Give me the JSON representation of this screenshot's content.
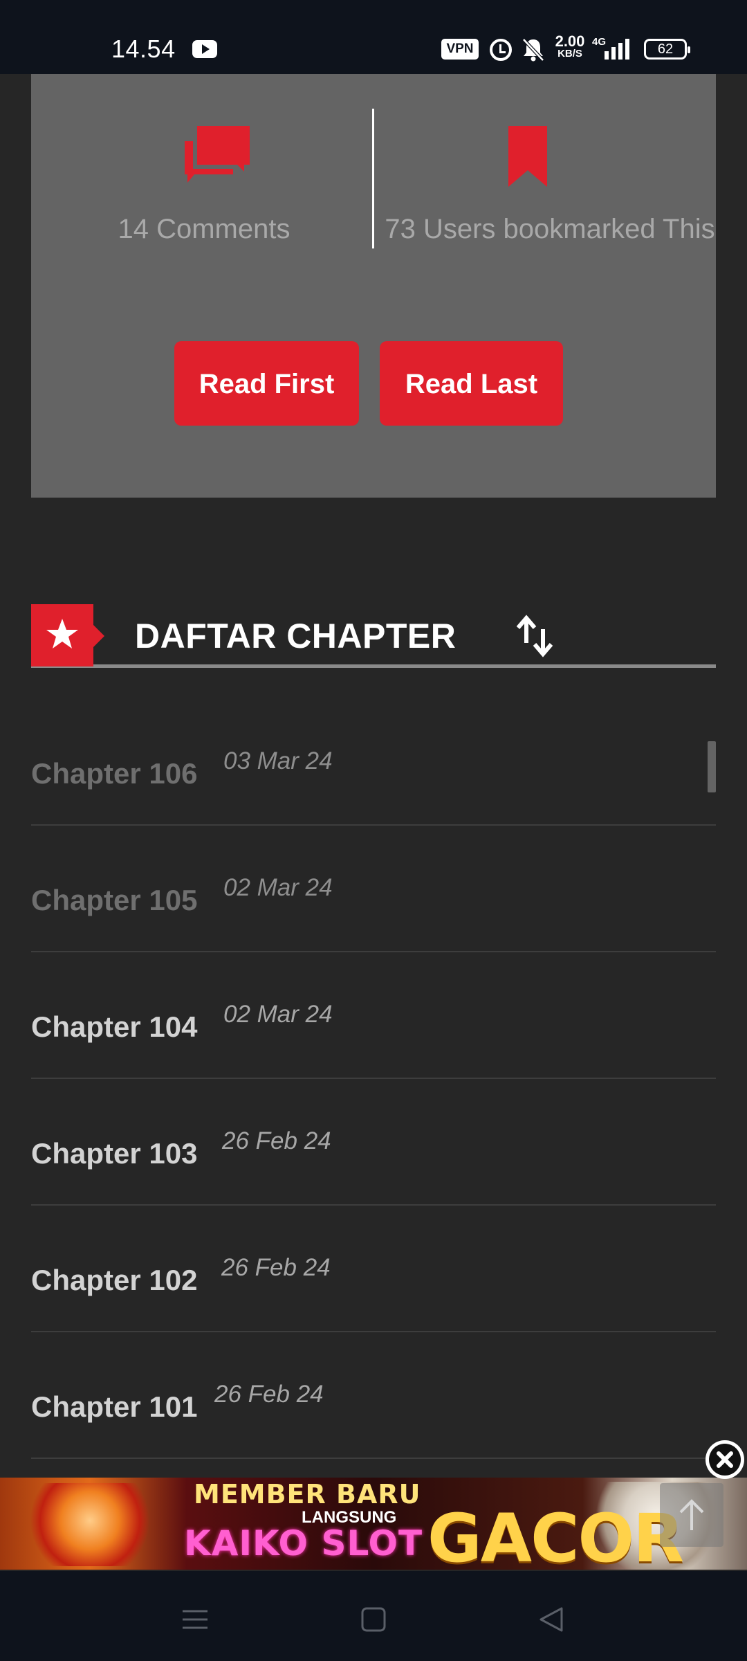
{
  "status_bar": {
    "time": "14.54",
    "vpn": "VPN",
    "net_speed": "2.00",
    "net_unit": "KB/S",
    "network": "4G",
    "battery": "62"
  },
  "info_card": {
    "comments": "14 Comments",
    "bookmarks": "73 Users bookmarked This",
    "read_first": "Read First",
    "read_last": "Read Last"
  },
  "chapters_section": {
    "title": "DAFTAR CHAPTER"
  },
  "chapters": [
    {
      "name": "Chapter 106",
      "date": "03 Mar 24",
      "read": true
    },
    {
      "name": "Chapter 105",
      "date": "02 Mar 24",
      "read": true
    },
    {
      "name": "Chapter 104",
      "date": "02 Mar 24",
      "read": false
    },
    {
      "name": "Chapter 103",
      "date": "26 Feb 24",
      "read": false
    },
    {
      "name": "Chapter 102",
      "date": "26 Feb 24",
      "read": false
    },
    {
      "name": "Chapter 101",
      "date": "26 Feb 24",
      "read": false
    }
  ],
  "ad": {
    "line1": "MEMBER BARU",
    "line2": "LANGSUNG",
    "line3": "KAIKO SLOT",
    "line4": "GACOR"
  },
  "colors": {
    "accent": "#e0202c",
    "background": "#262626",
    "card": "#646464"
  }
}
